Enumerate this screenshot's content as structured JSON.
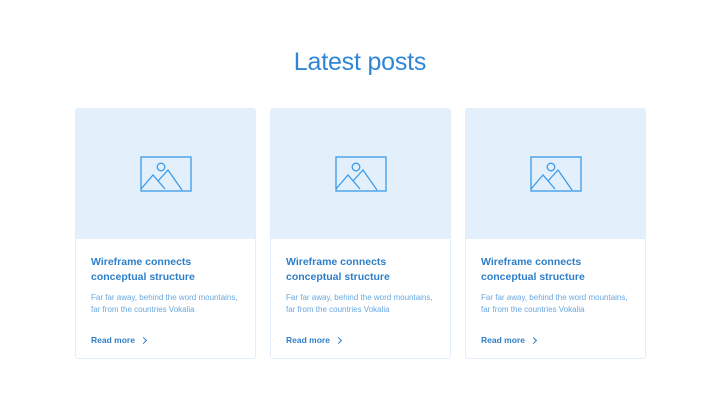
{
  "section": {
    "title": "Latest posts"
  },
  "posts": [
    {
      "title": "Wireframe connects conceptual structure",
      "excerpt": "Far far away, behind the word mountains, far from the countries Vokalia",
      "link_label": "Read more",
      "image_icon": "image-placeholder-icon"
    },
    {
      "title": "Wireframe connects conceptual structure",
      "excerpt": "Far far away, behind the word mountains, far from the countries Vokalia",
      "link_label": "Read more",
      "image_icon": "image-placeholder-icon"
    },
    {
      "title": "Wireframe connects conceptual structure",
      "excerpt": "Far far away, behind the word mountains, far from the countries Vokalia",
      "link_label": "Read more",
      "image_icon": "image-placeholder-icon"
    }
  ],
  "colors": {
    "accent": "#2f86d8",
    "title_text": "#2f7fc8",
    "body_text": "#6aa8df",
    "media_bg": "#e3f0fc",
    "card_border": "#e4eef8",
    "icon_stroke": "#3a9bea"
  }
}
